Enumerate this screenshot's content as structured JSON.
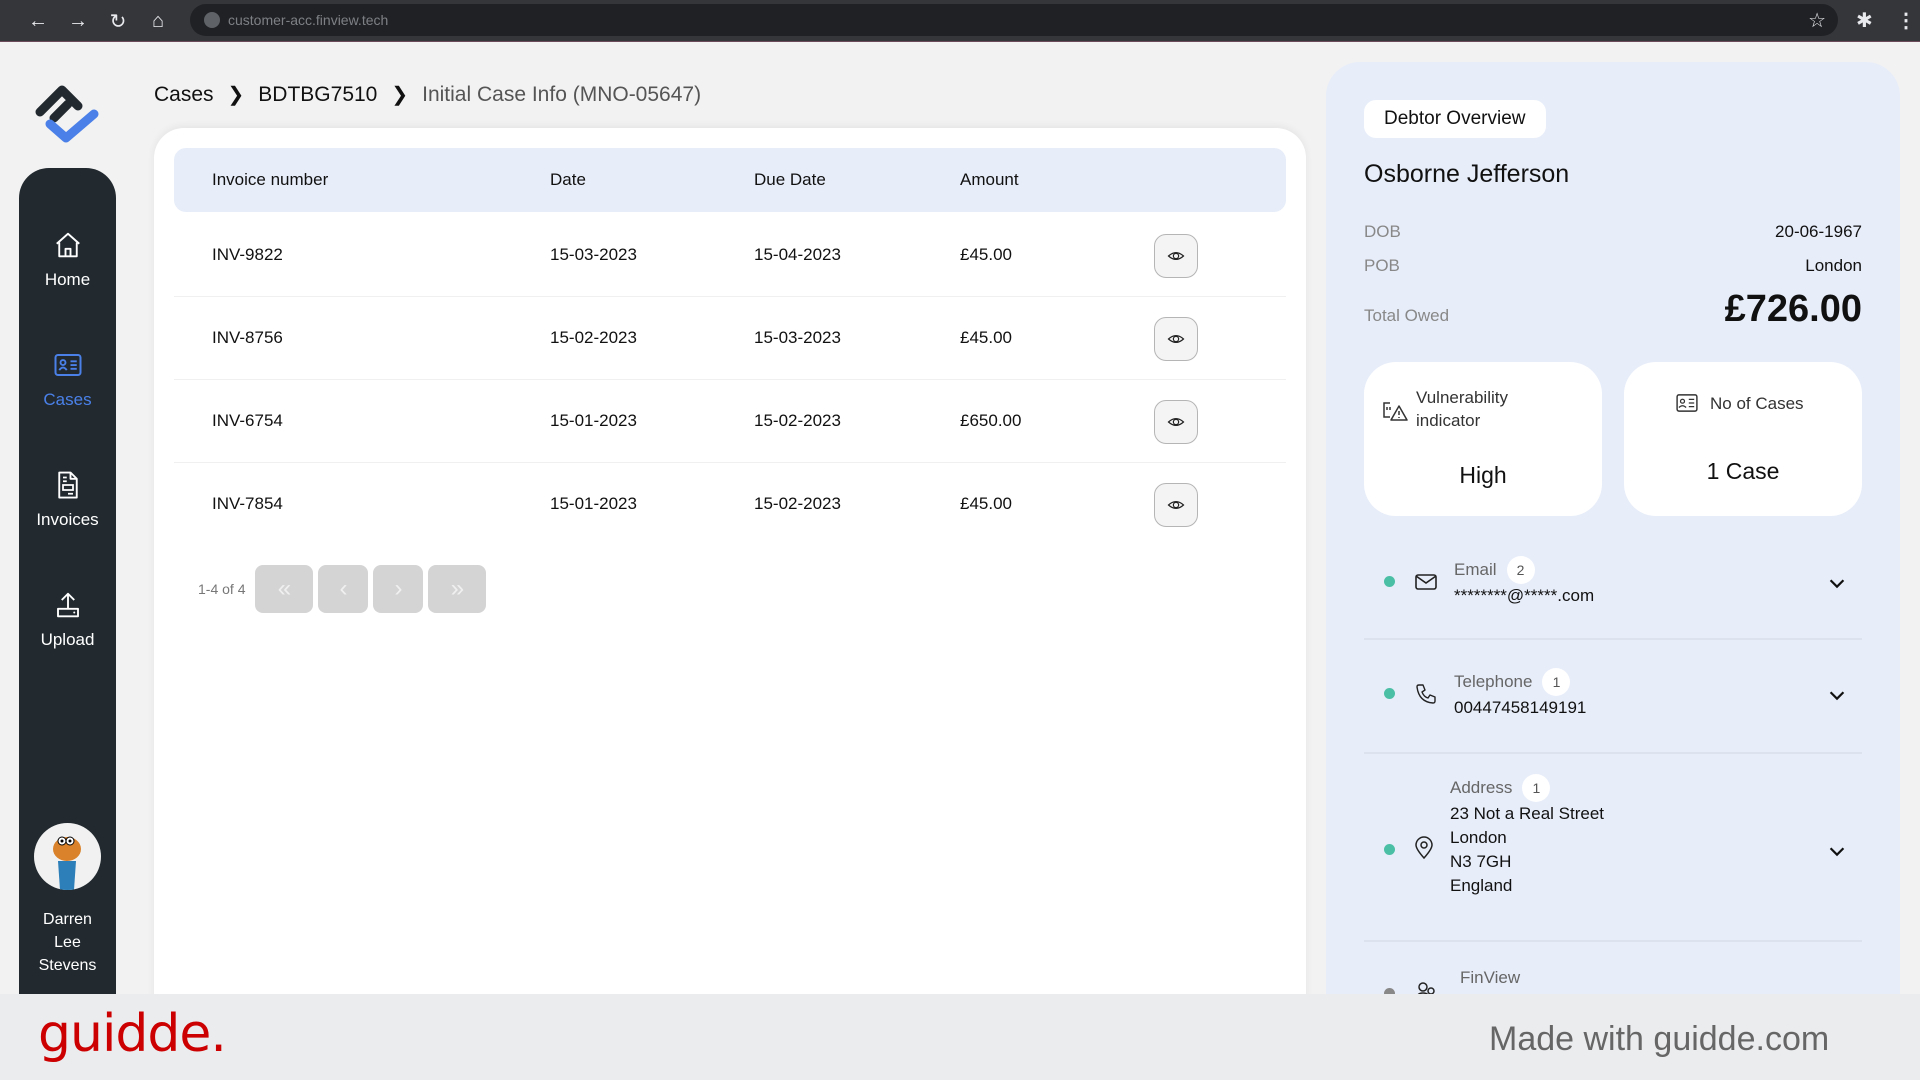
{
  "browser": {
    "url": "customer-acc.finview.tech",
    "icons": [
      "back-icon",
      "forward-icon",
      "reload-icon",
      "home-icon",
      "globe-icon",
      "star-icon",
      "extensions-icon",
      "menu-icon"
    ]
  },
  "sidebar": {
    "items": [
      {
        "label": "Home",
        "icon": "home-icon",
        "active": false
      },
      {
        "label": "Cases",
        "icon": "id-card-icon",
        "active": true
      },
      {
        "label": "Invoices",
        "icon": "document-icon",
        "active": false
      },
      {
        "label": "Upload",
        "icon": "upload-icon",
        "active": false
      }
    ],
    "user": {
      "name": "Darren Lee Stevens"
    }
  },
  "breadcrumb": {
    "items": [
      "Cases",
      "BDTBG7510",
      "Initial Case Info (MNO-05647)"
    ]
  },
  "invoices": {
    "columns": [
      "Invoice number",
      "Date",
      "Due Date",
      "Amount"
    ],
    "rows": [
      {
        "invoice": "INV-9822",
        "date": "15-03-2023",
        "due": "15-04-2023",
        "amount": "£45.00"
      },
      {
        "invoice": "INV-8756",
        "date": "15-02-2023",
        "due": "15-03-2023",
        "amount": "£45.00"
      },
      {
        "invoice": "INV-6754",
        "date": "15-01-2023",
        "due": "15-02-2023",
        "amount": "£650.00"
      },
      {
        "invoice": "INV-7854",
        "date": "15-01-2023",
        "due": "15-02-2023",
        "amount": "£45.00"
      }
    ],
    "pagination": {
      "info": "1-4 of 4",
      "buttons": [
        "«",
        "‹",
        "›",
        "»"
      ]
    }
  },
  "debtor": {
    "section_title": "Debtor Overview",
    "name": "Osborne Jefferson",
    "dob_label": "DOB",
    "dob": "20-06-1967",
    "pob_label": "POB",
    "pob": "London",
    "total_label": "Total Owed",
    "total": "£726.00",
    "vulnerability": {
      "label_line1": "Vulnerability",
      "label_line2": "indicator",
      "value": "High"
    },
    "cases": {
      "label": "No of Cases",
      "value": "1 Case"
    },
    "contacts": [
      {
        "title": "Email",
        "count": "2",
        "lines": [
          "********@*****.com"
        ],
        "status": "active",
        "icon": "mail-icon"
      },
      {
        "title": "Telephone",
        "count": "1",
        "lines": [
          "00447458149191"
        ],
        "status": "active",
        "icon": "phone-icon"
      },
      {
        "title": "Address",
        "count": "1",
        "lines": [
          "23 Not a Real Street",
          "London",
          "N3 7GH",
          "England"
        ],
        "status": "active",
        "icon": "location-pin-icon"
      },
      {
        "title": "FinView",
        "status": "inactive",
        "icon": "users-icon"
      }
    ],
    "colors": {
      "active_dot": "#4bbfa5",
      "inactive_dot": "#888888",
      "accent": "#4a80e8"
    }
  },
  "footer": {
    "brand": "guidde.",
    "made_with": "Made with guidde.com"
  }
}
